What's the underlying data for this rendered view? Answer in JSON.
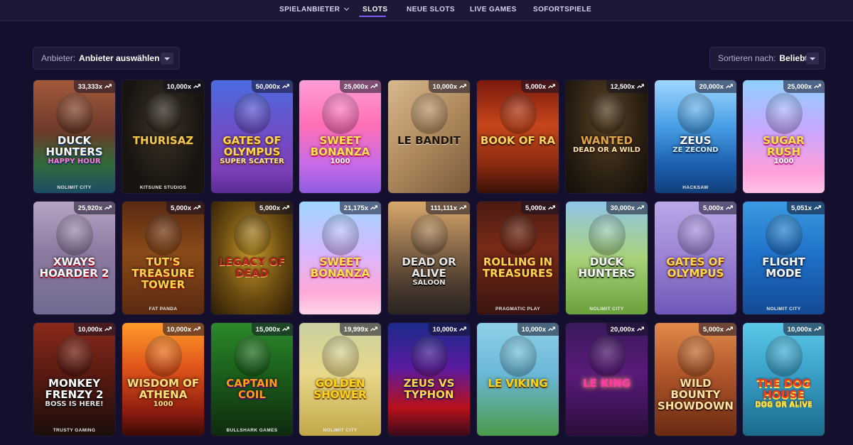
{
  "nav": {
    "items": [
      {
        "label": "SPIELANBIETER",
        "active": false,
        "has_dropdown": true
      },
      {
        "label": "SLOTS",
        "active": true
      },
      {
        "label": "NEUE SLOTS",
        "active": false
      },
      {
        "label": "LIVE GAMES",
        "active": false
      },
      {
        "label": "SOFORTSPIELE",
        "active": false
      }
    ]
  },
  "filters": {
    "provider": {
      "label": "Anbieter:",
      "value": "Anbieter auswählen"
    },
    "sort": {
      "label": "Sortieren nach:",
      "value": "Beliebt"
    }
  },
  "games": [
    {
      "title": "Duck Hunters",
      "subtitle": "Happy Hour",
      "studio": "NOLIMIT CITY",
      "multiplier": "33,333x"
    },
    {
      "title": "Thurisaz",
      "subtitle": "",
      "studio": "KITSUNE STUDIOS",
      "multiplier": "10,000x"
    },
    {
      "title": "Gates of Olympus",
      "subtitle": "Super Scatter",
      "studio": "",
      "multiplier": "50,000x"
    },
    {
      "title": "Sweet Bonanza",
      "subtitle": "1000",
      "studio": "",
      "multiplier": "25,000x"
    },
    {
      "title": "Le Bandit",
      "subtitle": "",
      "studio": "",
      "multiplier": "10,000x"
    },
    {
      "title": "Book of Ra",
      "subtitle": "",
      "studio": "",
      "multiplier": "5,000x"
    },
    {
      "title": "Wanted",
      "subtitle": "Dead or a Wild",
      "studio": "",
      "multiplier": "12,500x"
    },
    {
      "title": "Zeus",
      "subtitle": "Ze Zecond",
      "studio": "HACKSAW",
      "multiplier": "20,000x"
    },
    {
      "title": "Sugar Rush",
      "subtitle": "1000",
      "studio": "",
      "multiplier": "25,000x"
    },
    {
      "title": "xWays Hoarder 2",
      "subtitle": "",
      "studio": "",
      "multiplier": "25,920x"
    },
    {
      "title": "Tut's Treasure Tower",
      "subtitle": "",
      "studio": "FAT PANDA",
      "multiplier": "5,000x"
    },
    {
      "title": "Legacy of Dead",
      "subtitle": "",
      "studio": "",
      "multiplier": "5,000x"
    },
    {
      "title": "Sweet Bonanza",
      "subtitle": "",
      "studio": "",
      "multiplier": "21,175x"
    },
    {
      "title": "Dead or Alive",
      "subtitle": "Saloon",
      "studio": "",
      "multiplier": "111,111x"
    },
    {
      "title": "Rolling in Treasures",
      "subtitle": "",
      "studio": "PRAGMATIC PLAY",
      "multiplier": "5,000x"
    },
    {
      "title": "Duck Hunters",
      "subtitle": "",
      "studio": "NOLIMIT CITY",
      "multiplier": "30,000x"
    },
    {
      "title": "Gates of Olympus",
      "subtitle": "",
      "studio": "",
      "multiplier": "5,000x"
    },
    {
      "title": "Flight Mode",
      "subtitle": "",
      "studio": "NOLIMIT CITY",
      "multiplier": "5,051x"
    },
    {
      "title": "Monkey Frenzy 2",
      "subtitle": "Boss is Here!",
      "studio": "TRUSTY GAMING",
      "multiplier": "10,000x"
    },
    {
      "title": "Wisdom of Athena",
      "subtitle": "1000",
      "studio": "",
      "multiplier": "10,000x"
    },
    {
      "title": "Captain Coil",
      "subtitle": "",
      "studio": "BULLSHARK GAMES",
      "multiplier": "15,000x"
    },
    {
      "title": "Golden Shower",
      "subtitle": "",
      "studio": "NOLIMIT CITY",
      "multiplier": "19,999x"
    },
    {
      "title": "Zeus vs Typhon",
      "subtitle": "",
      "studio": "",
      "multiplier": "10,000x"
    },
    {
      "title": "Le Viking",
      "subtitle": "",
      "studio": "",
      "multiplier": "10,000x"
    },
    {
      "title": "Le King",
      "subtitle": "",
      "studio": "",
      "multiplier": "20,000x"
    },
    {
      "title": "Wild Bounty Showdown",
      "subtitle": "",
      "studio": "",
      "multiplier": "5,000x"
    },
    {
      "title": "The Dog House",
      "subtitle": "Dog or Alive",
      "studio": "",
      "multiplier": "10,000x"
    }
  ]
}
